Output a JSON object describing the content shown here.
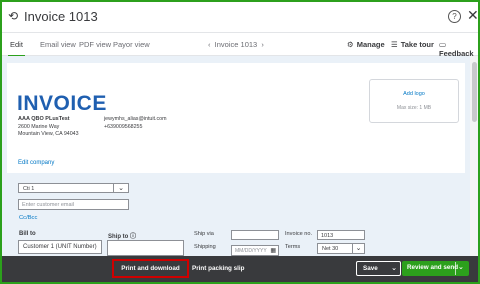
{
  "window": {
    "title": "Invoice 1013",
    "history_icon": "clock-history-icon",
    "help_icon": "help-icon",
    "close_icon": "close-icon"
  },
  "toolbar": {
    "tabs": [
      {
        "label": "Edit",
        "active": true
      },
      {
        "label": "Email view",
        "active": false
      },
      {
        "label": "PDF view",
        "active": false
      },
      {
        "label": "Payor view",
        "active": false
      }
    ],
    "nav": {
      "prev": "‹",
      "label": "Invoice 1013",
      "next": "›"
    },
    "actions": [
      {
        "label": "Manage",
        "icon": "gear-icon"
      },
      {
        "label": "Take tour",
        "icon": "tour-icon"
      },
      {
        "label": "Feedback",
        "icon": "feedback-icon"
      }
    ]
  },
  "invoice": {
    "heading": "INVOICE",
    "company": {
      "name": "AAA QBO PLusTest",
      "address_lines": [
        "2600 Marine Way",
        "Mountain View, CA 94043"
      ],
      "email": "jewymhs_alias@intuit.com",
      "phone": "+639009568255"
    },
    "edit_company_link": "Edit company",
    "logo": {
      "add_label": "Add logo",
      "max_size": "Max size: 1 MB"
    }
  },
  "form": {
    "customer_select": "Cti 1",
    "customer_email_placeholder": "Enter customer email",
    "cc_bcc_link": "Cc/Bcc",
    "bill_to_label": "Bill to",
    "bill_to_value": "Customer 1 (UNIT Number)",
    "ship_to_label": "Ship to",
    "ship_via_label": "Ship via",
    "shipping_label": "Shipping",
    "shipping_date_placeholder": "MM/DD/YYYY",
    "invoice_no_label": "Invoice no.",
    "invoice_no_value": "1013",
    "terms_label": "Terms",
    "terms_value": "Net 30"
  },
  "footer": {
    "print_download": "Print and download",
    "print_packing": "Print packing slip",
    "save": "Save",
    "review_send": "Review and send"
  },
  "colors": {
    "accent_green": "#2ca01c",
    "link_blue": "#0077c5",
    "heading_blue": "#1f5fb0",
    "footer_bg": "#393a3d",
    "highlight_red": "#d00000"
  }
}
